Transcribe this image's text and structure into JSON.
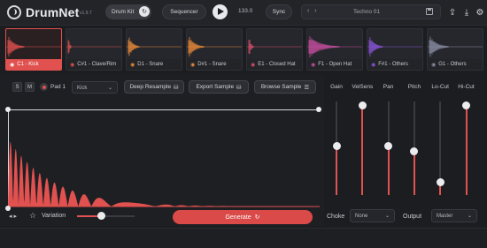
{
  "app": {
    "name": "DrumNet",
    "version": "v1.9.7"
  },
  "topbar": {
    "kit_label": "Drum Kit",
    "kit_toggle_icon": "refresh-icon",
    "sequencer_label": "Sequencer",
    "play_icon": "play-icon",
    "bpm": "133.0",
    "sync_label": "Sync",
    "preset_nav": "‹ ›",
    "preset_name": "Techno 01",
    "save_icon": "save-icon",
    "right_icons": [
      "upload-icon",
      "download-icon",
      "gear-icon"
    ]
  },
  "pads": [
    {
      "label": "C1 - Kick",
      "icon": "target-icon",
      "color": "#e0514f",
      "selected": true,
      "decay": 0.3
    },
    {
      "label": "C#1 - Clave/Rim",
      "icon": "drumstick-icon",
      "color": "#e0514f",
      "selected": false,
      "decay": 0.06
    },
    {
      "label": "D1 - Snare",
      "icon": "snare-icon",
      "color": "#e98a3a",
      "selected": false,
      "decay": 0.2
    },
    {
      "label": "D#1 - Snare",
      "icon": "snare-icon",
      "color": "#e98a3a",
      "selected": false,
      "decay": 0.28
    },
    {
      "label": "E1 - Closed Hat",
      "icon": "hihat-icon",
      "color": "#d64f6a",
      "selected": false,
      "decay": 0.1
    },
    {
      "label": "F1 - Open Hat",
      "icon": "hihat-icon",
      "color": "#c74ea1",
      "selected": false,
      "decay": 0.55
    },
    {
      "label": "F#1 - Others",
      "icon": "others-icon",
      "color": "#8a55d8",
      "selected": false,
      "decay": 0.25
    },
    {
      "label": "G1 - Others",
      "icon": "others-icon",
      "color": "#8a8da3",
      "selected": false,
      "decay": 0.35
    }
  ],
  "controls": {
    "solo_label": "S",
    "mute_label": "M",
    "pad_label": "Pad 1",
    "sample_dropdown": "Kick",
    "deep_resample": "Deep Resample",
    "export_sample": "Export Sample",
    "browse_sample": "Browse Sample"
  },
  "mixer": [
    {
      "label": "Gain",
      "value": 0.53
    },
    {
      "label": "VelSens",
      "value": 1.0
    },
    {
      "label": "Pan",
      "value": 0.53
    },
    {
      "label": "Pitch",
      "value": 0.46
    },
    {
      "label": "Lo-Cut",
      "value": 0.1
    },
    {
      "label": "Hi-Cut",
      "value": 1.0
    }
  ],
  "bottom": {
    "variation_label": "Variation",
    "variation_value": 0.42,
    "generate_label": "Generate",
    "choke_label": "Choke",
    "choke_value": "None",
    "output_label": "Output",
    "output_value": "Master"
  },
  "colors": {
    "accent": "#e0514f",
    "background": "#1c1d21"
  }
}
